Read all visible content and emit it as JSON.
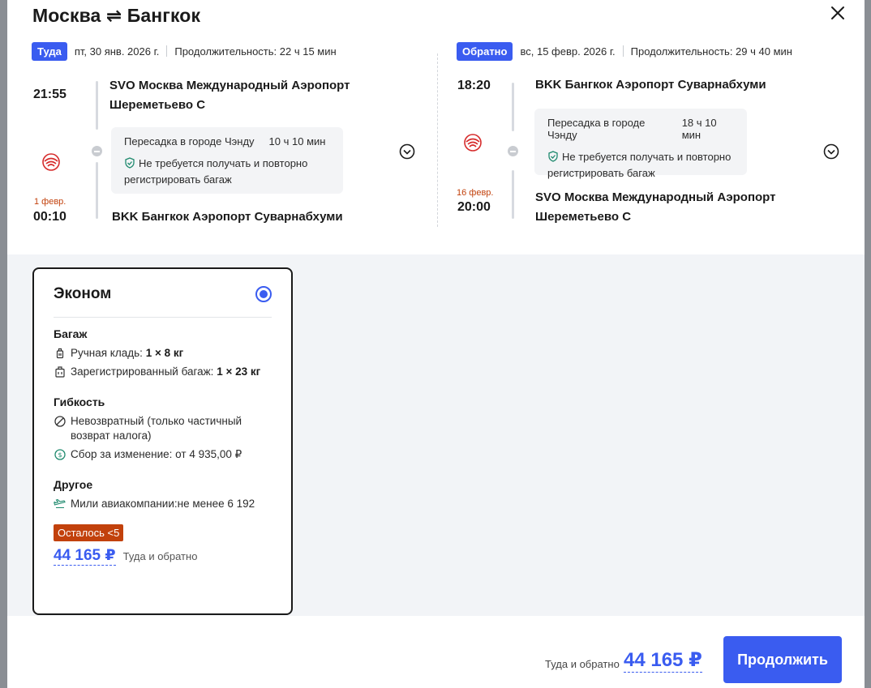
{
  "title": "Москва ⇌ Бангкок",
  "outbound": {
    "badge": "Туда",
    "date": "пт, 30 янв. 2026 г.",
    "duration": "Продолжительность: 22 ч 15 мин",
    "depart_time": "21:55",
    "depart_airport_line1": "SVO Москва Международный Аэропорт",
    "depart_airport_line2": "Шереметьево C",
    "transfer_city": "Пересадка в городе Чэнду",
    "transfer_time": "10 ч 10 мин",
    "transfer_note_line1": "Не требуется получать и повторно",
    "transfer_note_line2": "регистрировать багаж",
    "arrive_date_note": "1 февр.",
    "arrive_time": "00:10",
    "arrive_airport": "BKK Бангкок Аэропорт Суварнабхуми"
  },
  "return": {
    "badge": "Обратно",
    "date": "вс, 15 февр. 2026 г.",
    "duration": "Продолжительность: 29 ч 40 мин",
    "depart_time": "18:20",
    "depart_airport": "BKK Бангкок Аэропорт Суварнабхуми",
    "transfer_city": "Пересадка в городе Чэнду",
    "transfer_time": "18 ч 10 мин",
    "transfer_note_line1": "Не требуется получать и повторно",
    "transfer_note_line2": "регистрировать багаж",
    "arrive_date_note": "16 февр.",
    "arrive_time": "20:00",
    "arrive_airport_line1": "SVO Москва Международный Аэропорт",
    "arrive_airport_line2": "Шереметьево C"
  },
  "fare": {
    "name": "Эконом",
    "baggage_title": "Багаж",
    "carry_on_label": "Ручная кладь:",
    "carry_on_value": "1 × 8 кг",
    "checked_label": "Зарегистрированный багаж:",
    "checked_value": "1 × 23 кг",
    "flex_title": "Гибкость",
    "refund_line1": "Невозвратный (только частичный",
    "refund_line2": "возврат налога)",
    "change_fee": "Сбор за изменение: от 4 935,00 ₽",
    "other_title": "Другое",
    "miles": "Мили авиакомпании:не менее 6 192",
    "left_badge": "Осталось <5",
    "price": "44 165 ₽",
    "price_note": "Туда и обратно"
  },
  "footer": {
    "note": "Туда и обратно",
    "price": "44 165 ₽",
    "continue_label": "Продолжить"
  },
  "colors": {
    "accent": "#3a5cf0",
    "warning": "#c2410c"
  }
}
